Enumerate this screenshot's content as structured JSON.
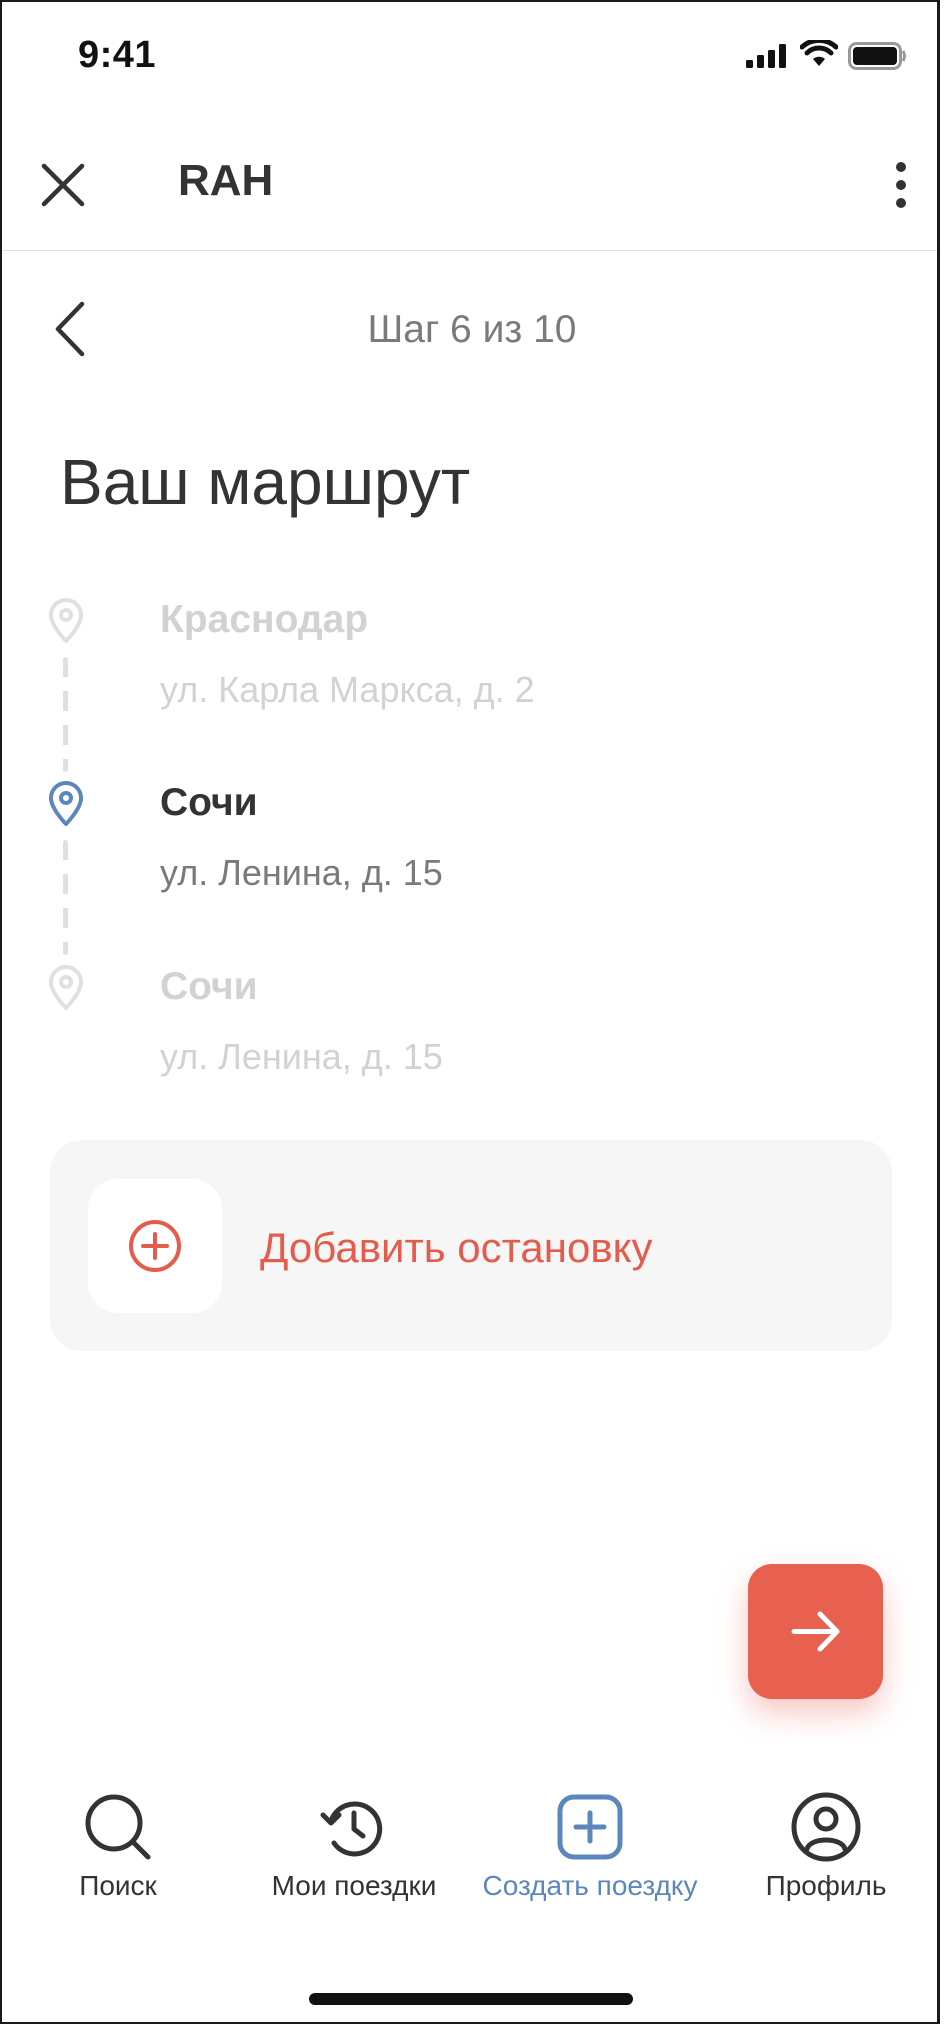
{
  "status_bar": {
    "time": "9:41"
  },
  "header": {
    "title": "RAH"
  },
  "wizard": {
    "step_text": "Шаг 6 из 10",
    "title": "Ваш маршрут"
  },
  "route": {
    "stops": [
      {
        "city": "Краснодар",
        "address": "ул. Карла Маркса, д. 2",
        "state": "inactive"
      },
      {
        "city": "Сочи",
        "address": "ул. Ленина, д. 15",
        "state": "active"
      },
      {
        "city": "Сочи",
        "address": "ул. Ленина, д. 15",
        "state": "inactive"
      }
    ]
  },
  "add_stop": {
    "label": "Добавить остановку"
  },
  "bottom_nav": {
    "items": [
      {
        "label": "Поиск",
        "icon": "search-icon",
        "active": false
      },
      {
        "label": "Мои поездки",
        "icon": "history-icon",
        "active": false
      },
      {
        "label": "Создать поездку",
        "icon": "plus-square-icon",
        "active": true
      },
      {
        "label": "Профиль",
        "icon": "profile-icon",
        "active": false
      }
    ]
  },
  "colors": {
    "accent": "#e8604f",
    "active_blue": "#5b87bd",
    "text": "#333333",
    "muted": "#d2d2d2"
  }
}
